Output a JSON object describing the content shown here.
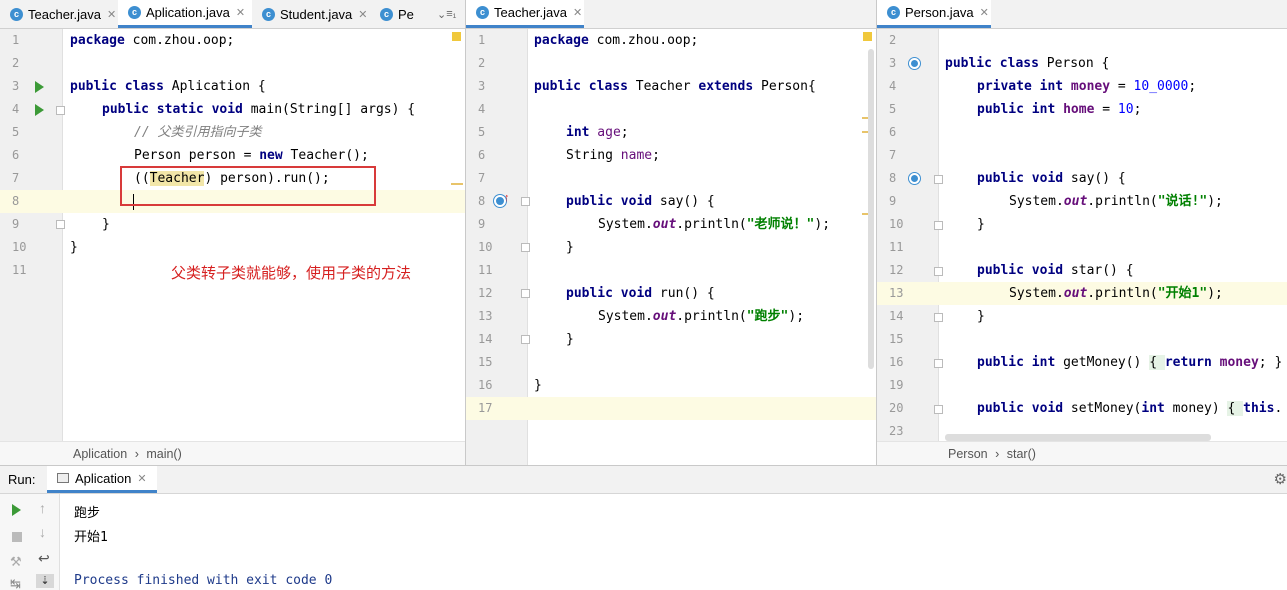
{
  "left_editor": {
    "tabs": [
      "Teacher.java",
      "Aplication.java",
      "Student.java",
      "Pe"
    ],
    "tab_overflow": "≡₁",
    "breadcrumb": [
      "Aplication",
      "main()"
    ],
    "line_numbers": [
      "1",
      "2",
      "3",
      "4",
      "5",
      "6",
      "7",
      "8",
      "9",
      "10",
      "11"
    ],
    "lines": {
      "l1_kw": "package",
      "l1_rest": " com.zhou.oop;",
      "l3_kw": "public class",
      "l3_rest": " Aplication {",
      "l4_kw": "public static void",
      "l4_rest": " main(String[] args) {",
      "l5": "// 父类引用指向子类",
      "l6_a": "Person person = ",
      "l6_kw": "new",
      "l6_b": " Teacher();",
      "l7_a": "((",
      "l7_cast": "Teacher",
      "l7_b": ") person).run();",
      "l9": "}",
      "l10": "}"
    },
    "annotation": "父类转子类就能够，使用子类的方法"
  },
  "middle_editor": {
    "tabs": [
      "Teacher.java"
    ],
    "line_numbers": [
      "1",
      "2",
      "3",
      "4",
      "5",
      "6",
      "7",
      "8",
      "9",
      "10",
      "11",
      "12",
      "13",
      "14",
      "15",
      "16",
      "17"
    ],
    "lines": {
      "l1_kw": "package",
      "l1_rest": " com.zhou.oop;",
      "l3_kw": "public class",
      "l3_mid": " Teacher ",
      "l3_kw2": "extends",
      "l3_rest": " Person{",
      "l5_kw": "int",
      "l5_f": " age",
      "l5_rest": ";",
      "l6_a": "String ",
      "l6_f": "name",
      "l6_rest": ";",
      "l8_kw": "public void",
      "l8_rest": " say() {",
      "l9_a": "System.",
      "l9_f": "out",
      "l9_b": ".println(",
      "l9_s": "\"老师说！\"",
      "l9_c": ");",
      "l10": "}",
      "l12_kw": "public void",
      "l12_rest": " run() {",
      "l13_a": "System.",
      "l13_f": "out",
      "l13_b": ".println(",
      "l13_s": "\"跑步\"",
      "l13_c": ");",
      "l14": "}",
      "l16": "}"
    }
  },
  "right_editor": {
    "tabs": [
      "Person.java"
    ],
    "breadcrumb": [
      "Person",
      "star()"
    ],
    "line_numbers": [
      "2",
      "3",
      "4",
      "5",
      "6",
      "7",
      "8",
      "9",
      "10",
      "11",
      "12",
      "13",
      "14",
      "15",
      "16",
      "19",
      "20",
      "23"
    ],
    "lines": {
      "l3_kw": "public class",
      "l3_rest": " Person {",
      "l4_kw": "private int",
      "l4_f": " money",
      "l4_eq": " = ",
      "l4_n": "10_0000",
      "l4_rest": ";",
      "l5_kw": "public int",
      "l5_f": " home",
      "l5_eq": " = ",
      "l5_n": "10",
      "l5_rest": ";",
      "l8_kw": "public void",
      "l8_rest": " say() {",
      "l9_a": "System.",
      "l9_f": "out",
      "l9_b": ".println(",
      "l9_s": "\"说话!\"",
      "l9_c": ");",
      "l10": "}",
      "l12_kw": "public void",
      "l12_rest": " star() {",
      "l13_a": "System.",
      "l13_f": "out",
      "l13_b": ".println(",
      "l13_s": "\"开始1\"",
      "l13_c": ");",
      "l14": "}",
      "l16_kw": "public int",
      "l16_a": " getMoney() ",
      "l16_b": "{ ",
      "l16_kw2": "return",
      "l16_f": " money",
      "l16_c": "; }",
      "l20_kw": "public void",
      "l20_a": " setMoney(",
      "l20_kw2": "int",
      "l20_b": " money) ",
      "l20_c": "{ ",
      "l20_kw3": "this",
      "l20_d": "."
    }
  },
  "run_panel": {
    "label": "Run:",
    "tab": "Aplication",
    "output": [
      "跑步",
      "开始1",
      "",
      "Process finished with exit code 0"
    ]
  },
  "colors": {
    "keyword": "#000080",
    "string": "#008000",
    "field": "#660e7a",
    "annotation_red": "#d62020",
    "accent_tab": "#4083c9"
  }
}
